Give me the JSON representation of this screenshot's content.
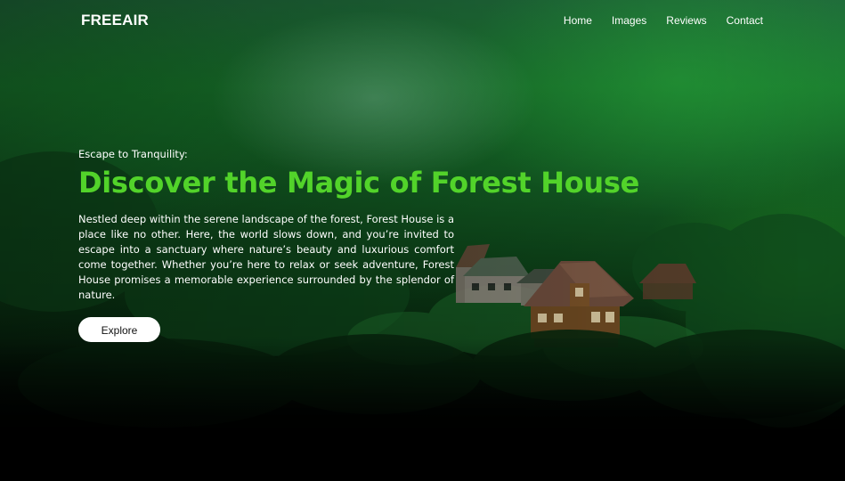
{
  "nav": {
    "logo": "FREEAIR",
    "links": [
      {
        "label": "Home"
      },
      {
        "label": "Images"
      },
      {
        "label": "Reviews"
      },
      {
        "label": "Contact"
      }
    ]
  },
  "hero": {
    "eyebrow": "Escape to Tranquility:",
    "headline": "Discover the Magic of Forest House",
    "description": "Nestled deep within the serene landscape of the forest, Forest House is a place like no other. Here, the world slows down, and you’re invited to escape into a sanctuary where nature’s beauty and luxurious comfort come together. Whether you’re here to relax or seek adventure, Forest House promises a memorable experience surrounded by the splendor of nature.",
    "cta_label": "Explore"
  },
  "colors": {
    "headline": "#52d32a",
    "button_bg": "#ffffff",
    "text": "#ffffff"
  }
}
